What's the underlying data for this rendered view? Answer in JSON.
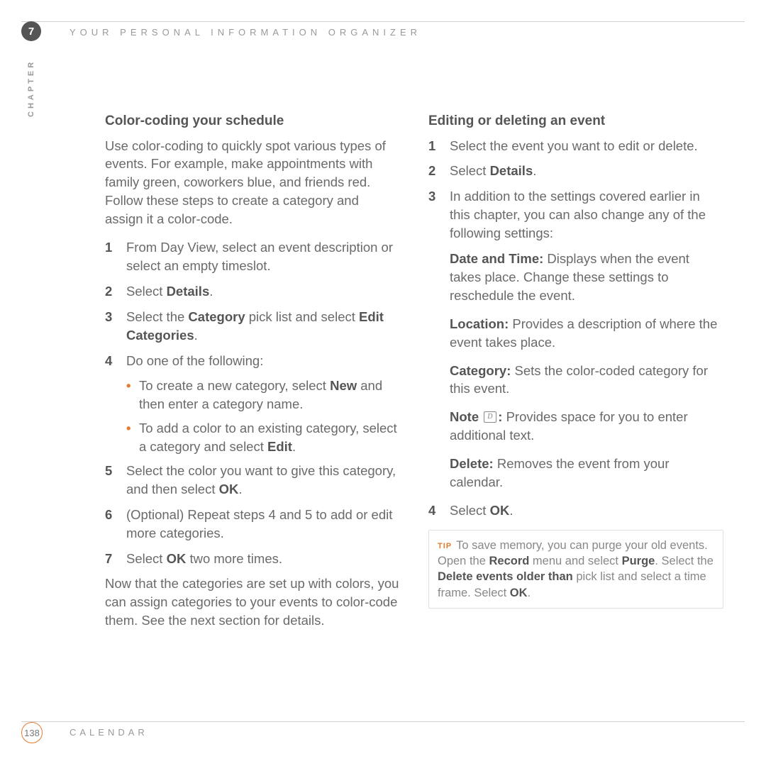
{
  "header": {
    "chapter_number": "7",
    "chapter_label": "CHAPTER",
    "title": "YOUR PERSONAL INFORMATION ORGANIZER"
  },
  "left": {
    "heading": "Color-coding your schedule",
    "intro": "Use color-coding to quickly spot various types of events. For example, make appointments with family green, coworkers blue, and friends red. Follow these steps to create a category and assign it a color-code.",
    "steps": {
      "s1": "From Day View, select an event description or select an empty timeslot.",
      "s2_pre": "Select ",
      "s2_b": "Details",
      "s2_post": ".",
      "s3_pre": "Select the ",
      "s3_b1": "Category",
      "s3_mid": " pick list and select ",
      "s3_b2": "Edit Categories",
      "s3_post": ".",
      "s4": "Do one of the following:",
      "s4b1_pre": "To create a new category, select ",
      "s4b1_b": "New",
      "s4b1_post": " and then enter a category name.",
      "s4b2_pre": "To add a color to an existing category, select a category and select ",
      "s4b2_b": "Edit",
      "s4b2_post": ".",
      "s5_pre": "Select the color you want to give this category, and then select ",
      "s5_b": "OK",
      "s5_post": ".",
      "s6": "(Optional) Repeat steps 4 and 5 to add or edit more categories.",
      "s7_pre": "Select ",
      "s7_b": "OK",
      "s7_post": " two more times."
    },
    "outro": "Now that the categories are set up with colors, you can assign categories to your events to color-code them. See the next section for details."
  },
  "right": {
    "heading": "Editing or deleting an event",
    "steps": {
      "s1": "Select the event you want to edit or delete.",
      "s2_pre": "Select ",
      "s2_b": "Details",
      "s2_post": ".",
      "s3": "In addition to the settings covered earlier in this chapter, you can also change any of the following settings:",
      "dt_label": "Date and Time:",
      "dt_text": " Displays when the event takes place. Change these settings to reschedule the event.",
      "loc_label": "Location:",
      "loc_text": " Provides a description of where the event takes place.",
      "cat_label": "Category:",
      "cat_text": " Sets the color-coded category for this event.",
      "note_label": "Note",
      "note_colon": ":",
      "note_text": " Provides space for you to enter additional text.",
      "del_label": "Delete:",
      "del_text": " Removes the event from your calendar.",
      "s4_pre": "Select ",
      "s4_b": "OK",
      "s4_post": "."
    },
    "tip": {
      "label": "TIP",
      "t1": "To save memory, you can purge your old events. Open the ",
      "b1": "Record",
      "t2": " menu and select ",
      "b2": "Purge",
      "t3": ". Select the ",
      "b3": "Delete events older than",
      "t4": " pick list and select a time frame. Select ",
      "b4": "OK",
      "t5": "."
    }
  },
  "footer": {
    "page": "138",
    "section": "CALENDAR"
  }
}
